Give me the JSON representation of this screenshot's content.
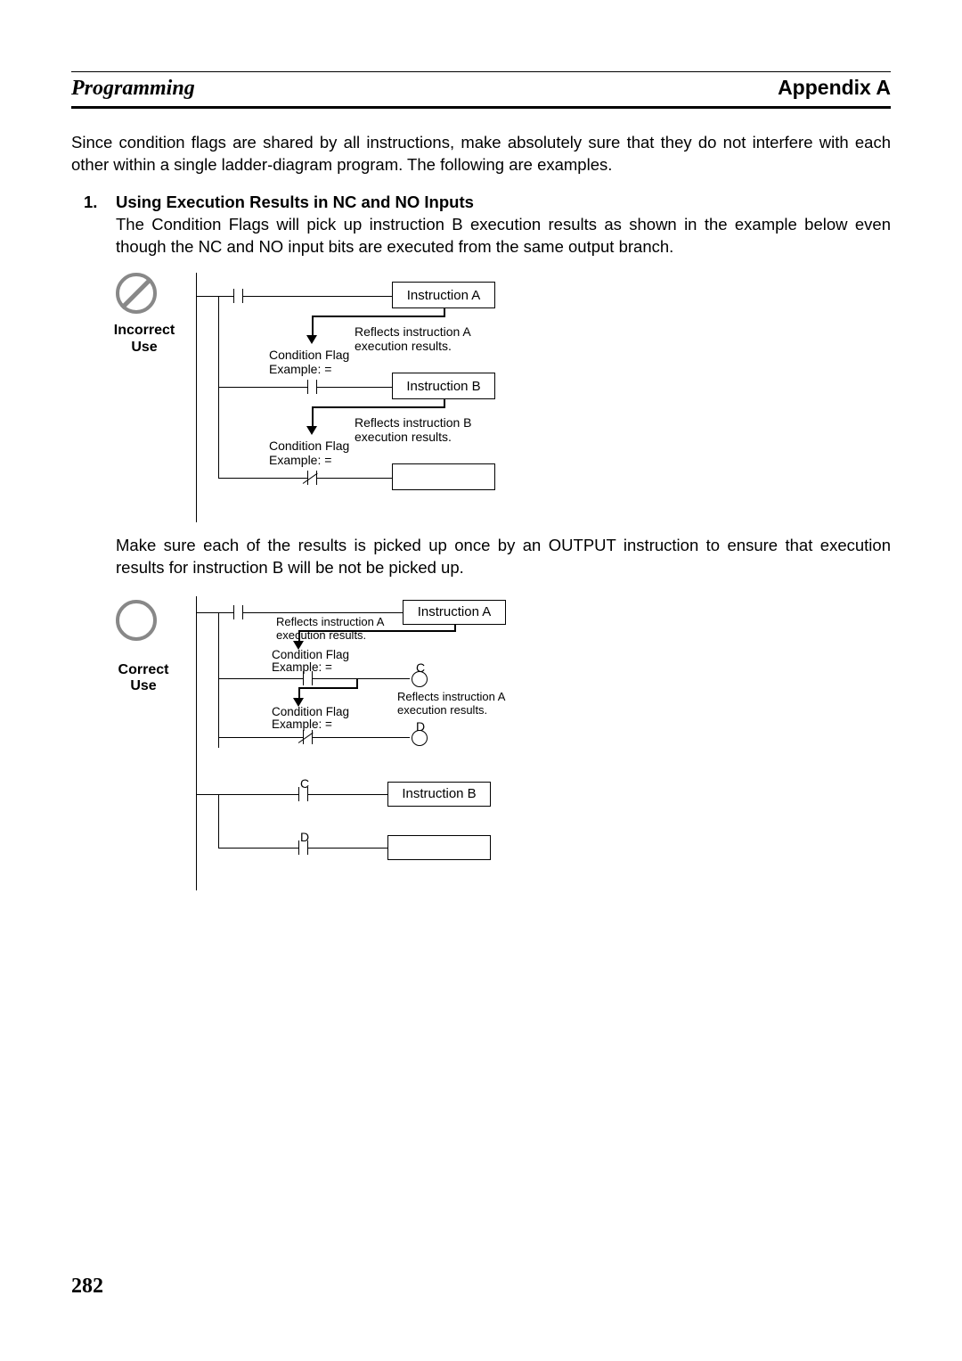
{
  "header": {
    "left": "Programming",
    "right": "Appendix A"
  },
  "page_number": "282",
  "intro": "Since condition flags are shared by all instructions, make absolutely sure that they do not interfere with each other within a single ladder-diagram program. The following are examples.",
  "item1": {
    "num": "1.",
    "title": "Using Execution Results in NC and NO Inputs",
    "text": "The Condition Flags will pick up instruction B execution results as shown in the example below even though the NC and NO input bits are executed from the same output branch."
  },
  "mid_text": "Make sure each of the results is picked up once by an OUTPUT instruction to ensure that execution results for instruction B will be not be picked up.",
  "labels": {
    "instrA": "Instruction A",
    "instrB": "Instruction B",
    "cf": "Condition Flag",
    "ex": "Example: =",
    "reflA": "Reflects instruction A\nexecution results.",
    "reflB": "Reflects instruction B\nexecution results.",
    "C": "C",
    "D": "D"
  },
  "side": {
    "incorrect": "Incorrect\nUse",
    "correct": "Correct\nUse"
  }
}
